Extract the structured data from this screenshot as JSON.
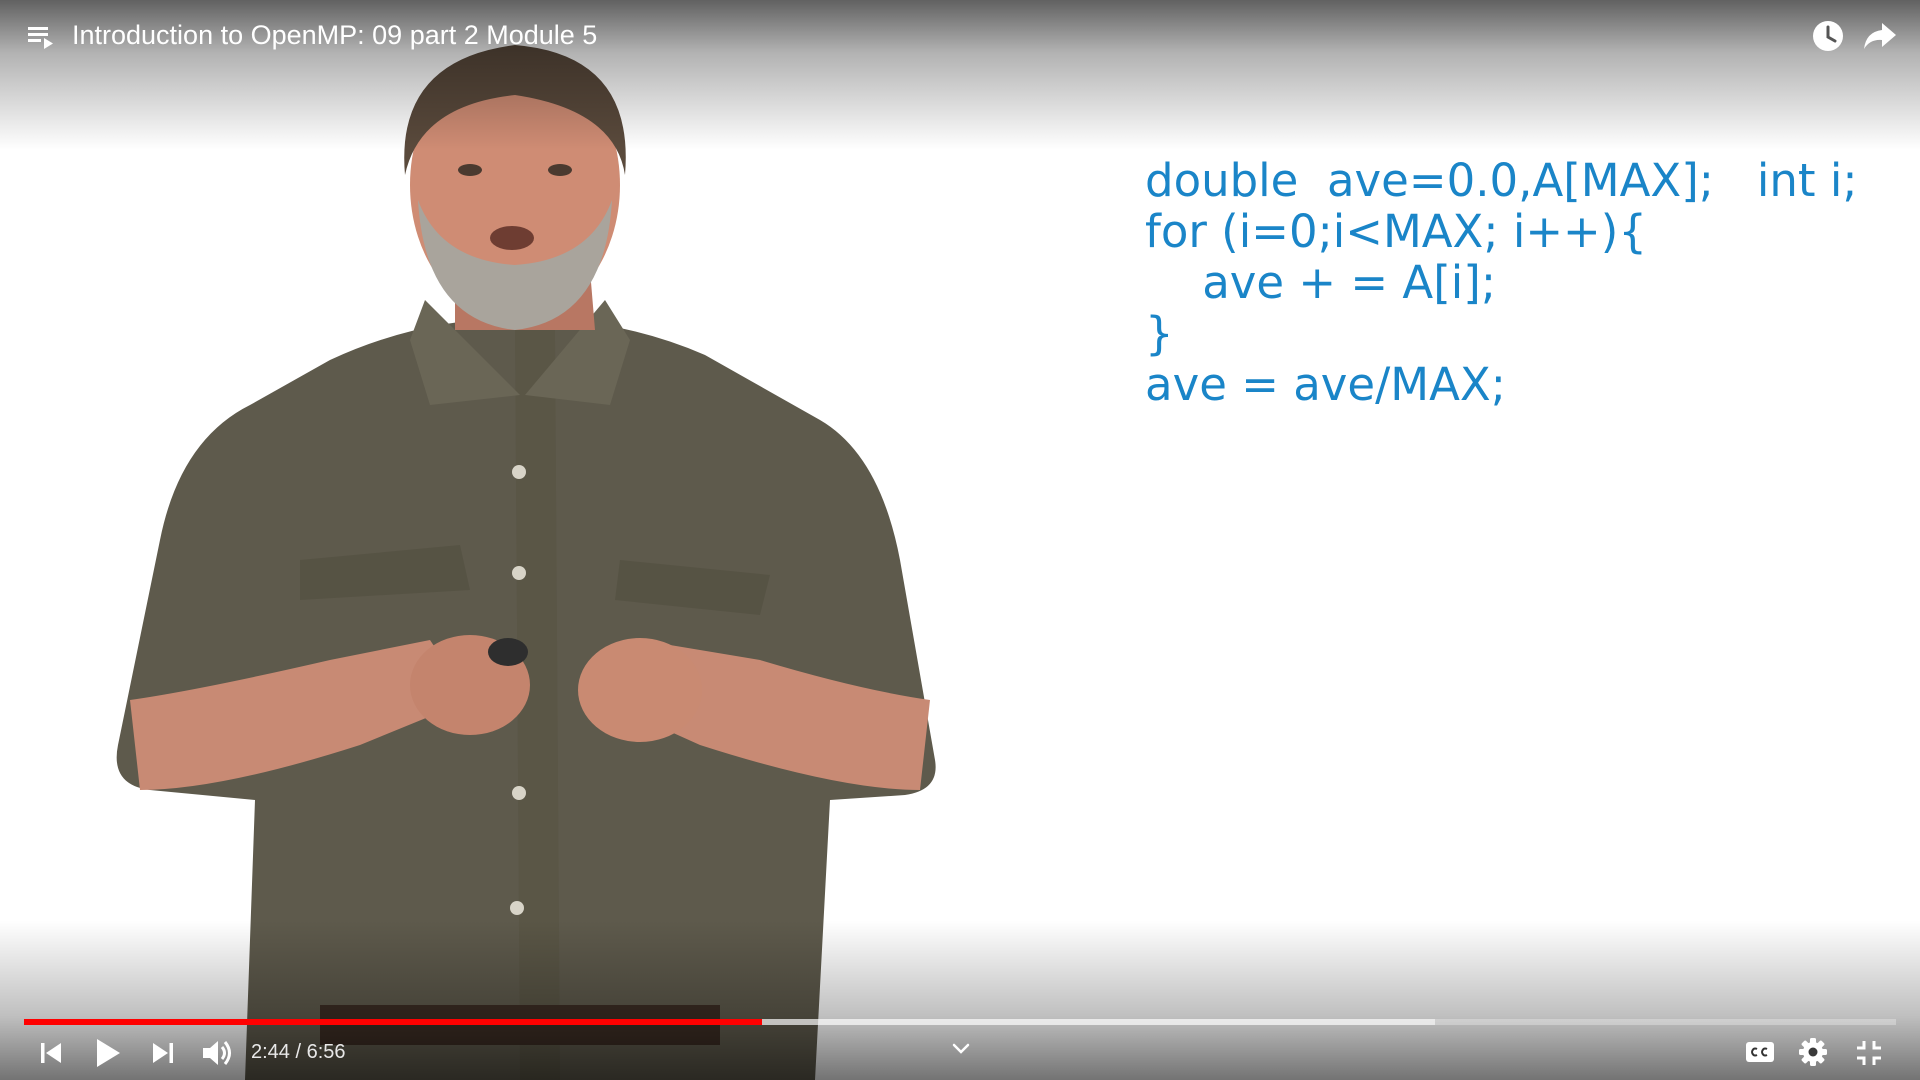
{
  "player": {
    "title": "Introduction to OpenMP: 09 part 2 Module 5",
    "time": {
      "current": "2:44",
      "separator": " / ",
      "duration": "6:56"
    },
    "progress": {
      "played_fraction": 0.394,
      "buffered_fraction": 0.754
    },
    "accent_color": "#ff0000"
  },
  "slide": {
    "code_color": "#1a85c8",
    "code_lines": [
      "double  ave=0.0,A[MAX];   int i;",
      "for (i=0;i<MAX; i++){",
      "    ave + = A[i];",
      "}",
      "ave = ave/MAX;"
    ]
  },
  "icons": {
    "top_left": "playlist-icon",
    "top_right": [
      "watch-later-icon",
      "share-icon"
    ],
    "bottom_left": [
      "previous-icon",
      "play-icon",
      "next-icon",
      "volume-icon"
    ],
    "bottom_center": "chevron-down-icon",
    "bottom_right": [
      "closed-captions-icon",
      "settings-gear-icon",
      "exit-fullscreen-icon"
    ]
  }
}
